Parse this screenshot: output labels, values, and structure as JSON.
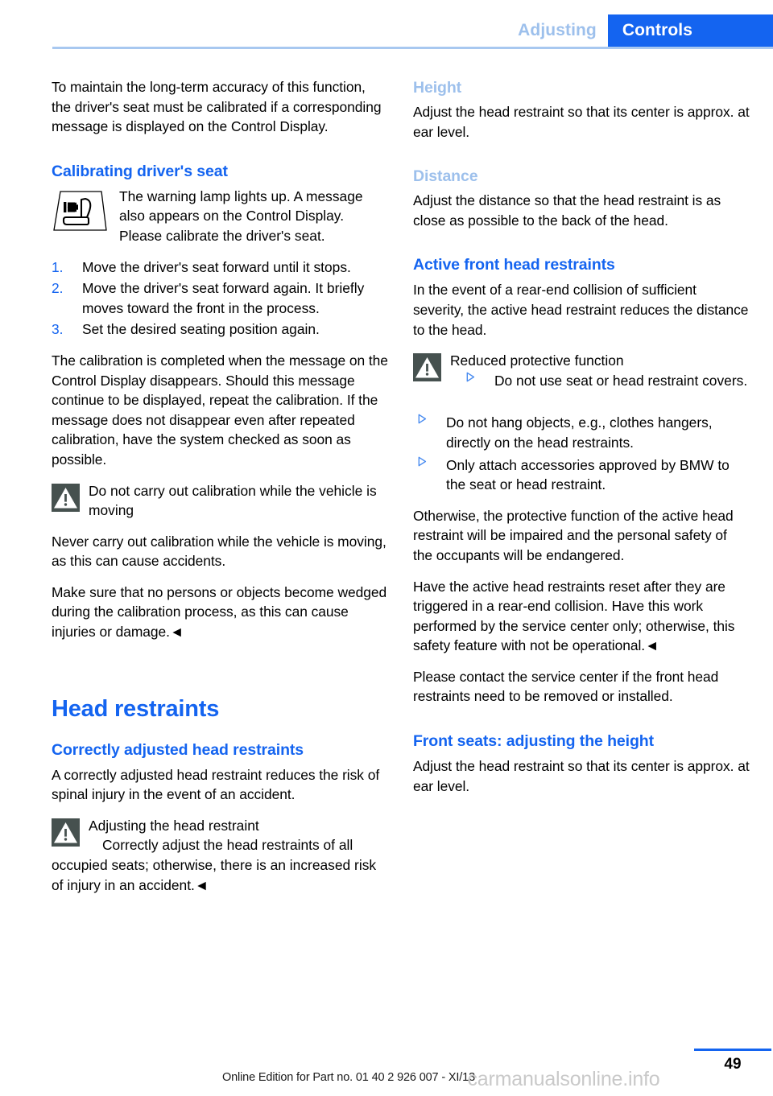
{
  "header": {
    "breadcrumb_inactive": "Adjusting",
    "breadcrumb_active": "Controls",
    "accent_blue": "#1464f0",
    "light_blue": "#9dc0ec"
  },
  "left_column": {
    "intro_paragraph": "To maintain the long-term accuracy of this function, the driver's seat must be calibrated if a corresponding message is displayed on the Control Display.",
    "calibrating_heading": "Calibrating driver's seat",
    "lamp_notice": "The warning lamp lights up. A message also appears on the Control Display. Please calibrate the driver's seat.",
    "steps": [
      {
        "num": "1.",
        "text": "Move the driver's seat forward until it stops."
      },
      {
        "num": "2.",
        "text": "Move the driver's seat forward again. It briefly moves toward the front in the process."
      },
      {
        "num": "3.",
        "text": "Set the desired seating position again."
      }
    ],
    "calibration_result": "The calibration is completed when the message on the Control Display disappears. Should this message continue to be displayed, repeat the calibration. If the message does not disappear even after repeated calibration, have the system checked as soon as possible.",
    "warning_1": {
      "title": "Do not carry out calibration while the vehicle is moving",
      "body_1": "Never carry out calibration while the vehicle is moving, as this can cause accidents.",
      "body_2": "Make sure that no persons or objects become wedged during the calibration process, as this can cause injuries or damage.◄"
    },
    "head_restraints_heading": "Head restraints",
    "correctly_adjusted_heading": "Correctly adjusted head restraints",
    "correctly_adjusted_body": "A correctly adjusted head restraint reduces the risk of spinal injury in the event of an accident.",
    "warning_2": {
      "title": "Adjusting the head restraint",
      "body": "Correctly adjust the head restraints of all occupied seats; otherwise, there is an increased risk of injury in an accident.◄"
    }
  },
  "right_column": {
    "height_heading": "Height",
    "height_body": "Adjust the head restraint so that its center is approx. at ear level.",
    "distance_heading": "Distance",
    "distance_body": "Adjust the distance so that the head restraint is as close as possible to the back of the head.",
    "active_heading": "Active front head restraints",
    "active_body": "In the event of a rear-end collision of sufficient severity, the active head restraint reduces the distance to the head.",
    "warning_3": {
      "title": "Reduced protective function",
      "bullets_indented": [
        "Do not use seat or head restraint covers."
      ],
      "bullets": [
        "Do not hang objects, e.g., clothes hangers, directly on the head restraints.",
        "Only attach accessories approved by BMW to the seat or head restraint."
      ],
      "body_1": "Otherwise, the protective function of the active head restraint will be impaired and the personal safety of the occupants will be endangered.",
      "body_2": "Have the active head restraints reset after they are triggered in a rear-end collision. Have this work performed by the service center only; otherwise, this safety feature with not be operational.◄"
    },
    "service_note": "Please contact the service center if the front head restraints need to be removed or installed.",
    "front_seats_heading": "Front seats: adjusting the height",
    "front_seats_body": "Adjust the head restraint so that its center is approx. at ear level."
  },
  "footer": {
    "page_number": "49",
    "online_edition": "Online Edition for Part no. 01 40 2 926 007 - XI/13",
    "watermark": "carmanualsonline.info"
  }
}
